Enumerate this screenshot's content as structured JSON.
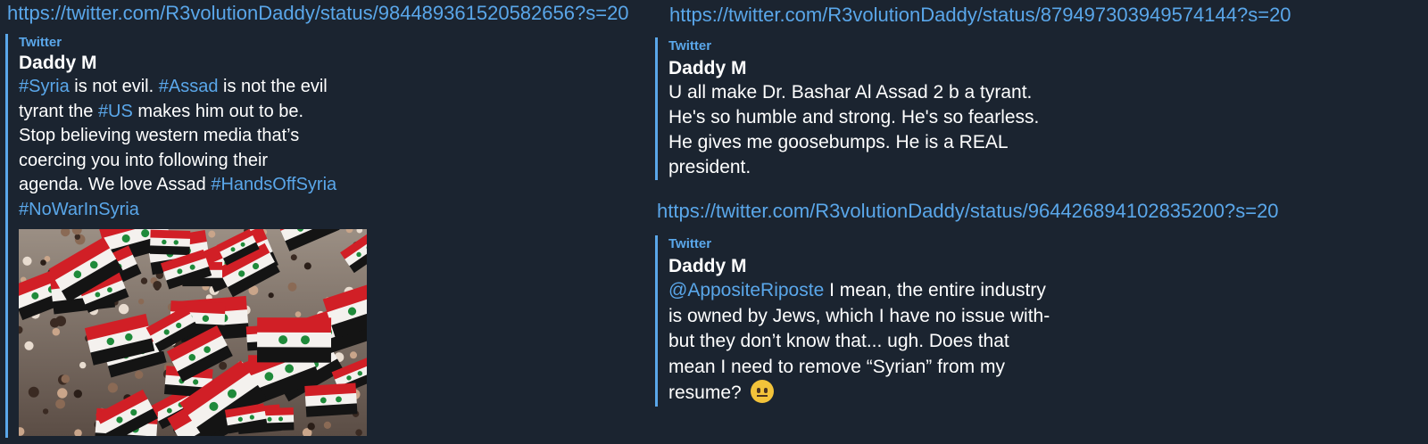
{
  "left": {
    "url": "https://twitter.com/R3volutionDaddy/status/984489361520582656?s=20",
    "site": "Twitter",
    "author": "Daddy M",
    "text_segments": [
      {
        "t": "#Syria",
        "tag": true
      },
      {
        "t": " is not evil. ",
        "tag": false
      },
      {
        "t": "#Assad",
        "tag": true
      },
      {
        "t": " is not the evil",
        "tag": false
      },
      {
        "t": "\n",
        "tag": false
      },
      {
        "t": "tyrant the ",
        "tag": false
      },
      {
        "t": "#US",
        "tag": true
      },
      {
        "t": " makes him out to be.",
        "tag": false
      },
      {
        "t": "\n",
        "tag": false
      },
      {
        "t": "Stop believing western media that’s",
        "tag": false
      },
      {
        "t": "\n",
        "tag": false
      },
      {
        "t": "coercing you into following their",
        "tag": false
      },
      {
        "t": "\n",
        "tag": false
      },
      {
        "t": "agenda. We love Assad ",
        "tag": false
      },
      {
        "t": "#HandsOffSyria",
        "tag": true
      },
      {
        "t": "\n",
        "tag": false
      },
      {
        "t": "#NoWarInSyria",
        "tag": true
      }
    ]
  },
  "right_top": {
    "url": "https://twitter.com/R3volutionDaddy/status/879497303949574144?s=20",
    "site": "Twitter",
    "author": "Daddy M",
    "lines": [
      "U all make Dr. Bashar Al Assad 2 b a tyrant.",
      "He's so humble and strong. He's so fearless.",
      "He gives me goosebumps. He is a REAL",
      "president."
    ]
  },
  "right_bottom": {
    "url": "https://twitter.com/R3volutionDaddy/status/964426894102835200?s=20",
    "site": "Twitter",
    "author": "Daddy M",
    "mention": "@AppositeRiposte",
    "line1_rest": " I mean, the entire industry",
    "lines": [
      "is owned by Jews, which I have no issue with-",
      "but they don’t know that... ugh. Does that",
      "mean I need to remove “Syrian” from my"
    ],
    "last_line": "resume?",
    "emoji": "neutral-face-emoji"
  },
  "colors": {
    "background": "#1b2430",
    "link": "#5aa7ea",
    "text": "#ffffff"
  }
}
